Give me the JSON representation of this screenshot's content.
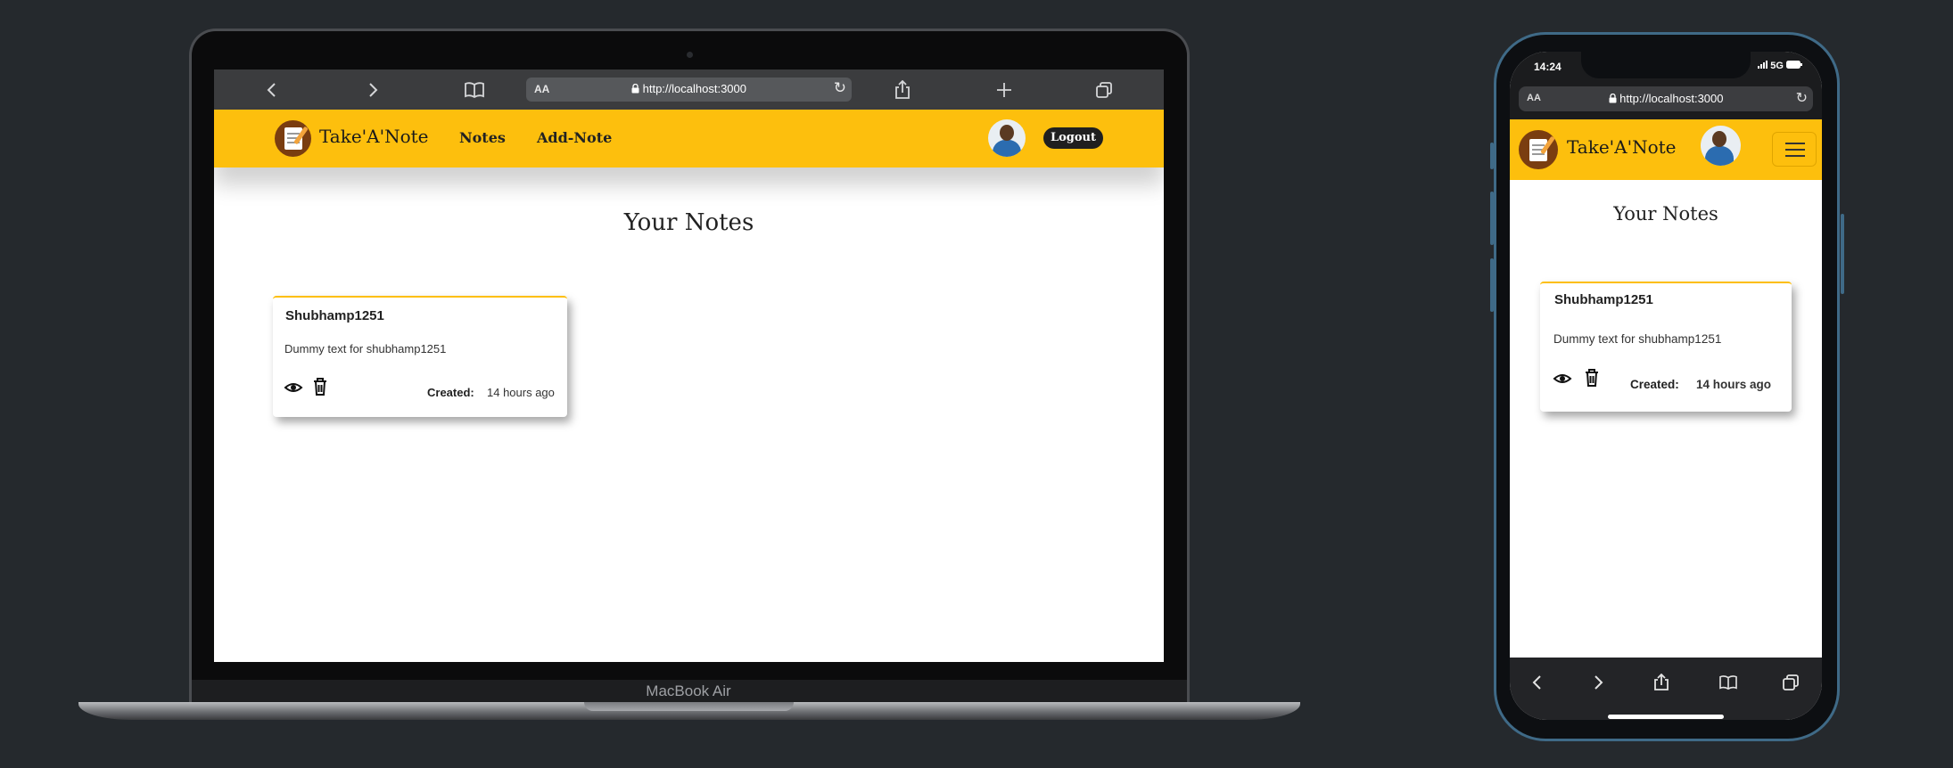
{
  "browser": {
    "url": "http://localhost:3000",
    "text_size_label": "AA"
  },
  "app": {
    "brand": "Take'A'Note",
    "nav_links": [
      "Notes",
      "Add-Note"
    ],
    "logout_label": "Logout",
    "page_title": "Your  Notes"
  },
  "note": {
    "user": "Shubhamp1251",
    "description": "Dummy text for shubhamp1251",
    "created_label": "Created:",
    "created_value": "14 hours ago"
  },
  "device": {
    "laptop_label": "MacBook Air",
    "phone_time": "14:24",
    "phone_network": "5G"
  },
  "icons": {
    "back": "chevron-left-icon",
    "forward": "chevron-right-icon",
    "bookmarks": "book-icon",
    "reload": "reload-icon",
    "share": "share-icon",
    "new_tab": "plus-icon",
    "tabs": "tabs-icon",
    "lock": "lock-icon",
    "view": "eye-icon",
    "delete": "trash-icon",
    "menu": "hamburger-icon"
  },
  "colors": {
    "accent": "#fdbf0d",
    "background": "#25292d",
    "logout_bg": "#1f1f1f"
  }
}
